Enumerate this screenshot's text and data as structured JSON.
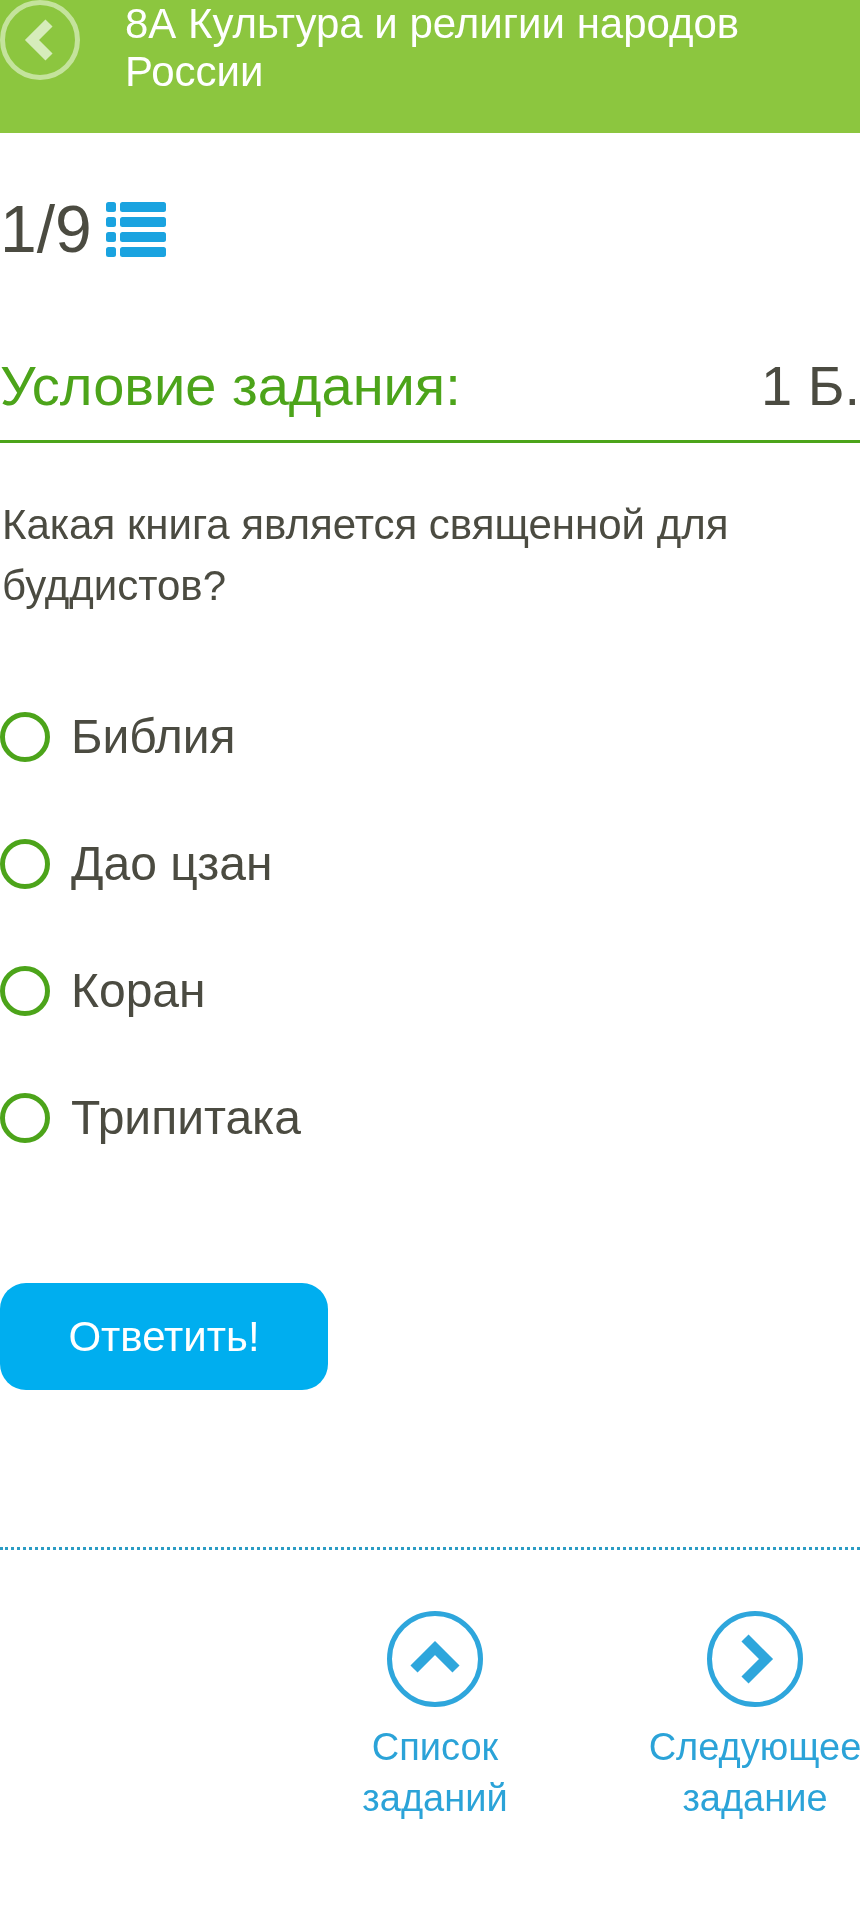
{
  "header": {
    "title": "8А Культура и религии народов России"
  },
  "task_counter": "1/9",
  "section": {
    "heading": "Условие задания:",
    "points": "1 Б."
  },
  "question": "Какая книга является священной для буддистов?",
  "options": [
    {
      "label": "Библия",
      "selected": false
    },
    {
      "label": "Дао цзан",
      "selected": false
    },
    {
      "label": "Коран",
      "selected": false
    },
    {
      "label": "Трипитака",
      "selected": false
    }
  ],
  "submit_button": "Ответить!",
  "nav": [
    {
      "kind": "up",
      "label": "Список заданий"
    },
    {
      "kind": "next",
      "label": "Следующее задание"
    }
  ]
}
